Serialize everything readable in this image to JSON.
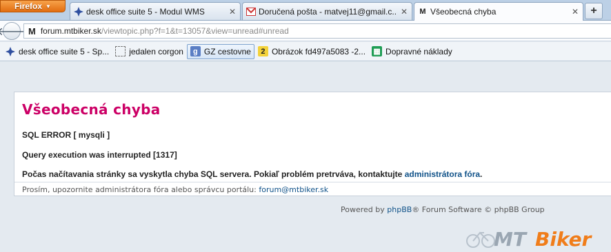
{
  "browser": {
    "menu_button": "Firefox",
    "tabs": [
      {
        "title": "desk office suite 5 - Modul WMS",
        "icon": "desk-office-icon"
      },
      {
        "title": "Doručená pošta - matvej11@gmail.c...",
        "icon": "gmail-icon"
      },
      {
        "title": "Všeobecná chyba",
        "icon": "mtbiker-icon"
      }
    ],
    "new_tab": "+",
    "url_host": "forum.mtbiker.sk",
    "url_path": "/viewtopic.php?f=1&t=13057&view=unread#unread",
    "favicon_text": "M"
  },
  "bookmarks": [
    {
      "label": "desk office suite 5 - Sp...",
      "icon": "desk-office-icon"
    },
    {
      "label": "jedalen corgon",
      "icon": "blank-page-icon"
    },
    {
      "label": "GZ cestovne",
      "icon": "google-docs-icon"
    },
    {
      "label": "Obrázok fd497a5083 -2...",
      "icon": "image-host-icon"
    },
    {
      "label": "Dopravné náklady",
      "icon": "spreadsheet-icon"
    }
  ],
  "page": {
    "title": "Všeobecná chyba",
    "sql_error": "SQL ERROR [ mysqli ]",
    "query_message": "Query execution was interrupted [1317]",
    "load_error_text": "Počas načítavania stránky sa vyskytla chyba SQL servera. Pokiaľ problém pretrváva, kontaktujte",
    "load_error_link": "administrátora fóra",
    "load_error_end": ".",
    "footer_text": "Prosím, upozornite administrátora fóra alebo správcu portálu:",
    "footer_email": "forum@mtbiker.sk",
    "powered_prefix": "Powered by",
    "powered_link": "phpBB",
    "powered_suffix": "® Forum Software © phpBB Group",
    "logo_text": "MTBiker",
    "accent_color": "#cc0066",
    "link_color": "#105289"
  }
}
